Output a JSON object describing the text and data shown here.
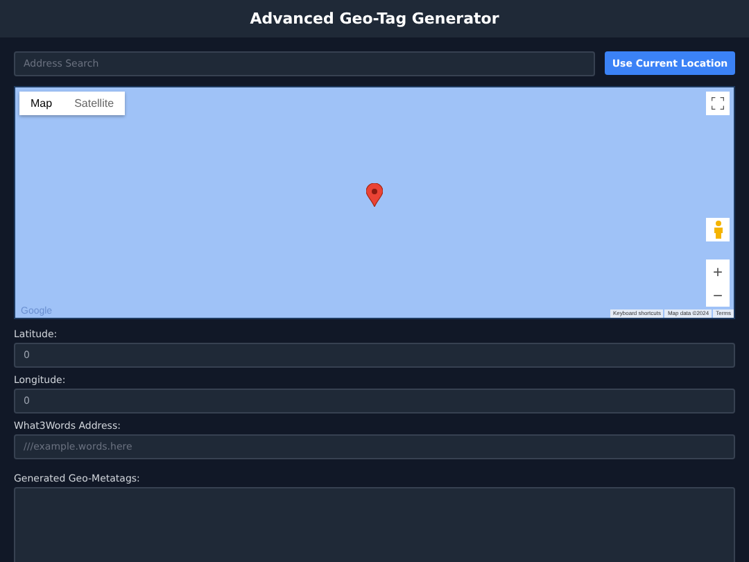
{
  "header": {
    "title": "Advanced Geo-Tag Generator"
  },
  "search": {
    "placeholder": "Address Search",
    "button": "Use Current Location"
  },
  "map": {
    "tabs": [
      {
        "label": "Map",
        "selected": true
      },
      {
        "label": "Satellite",
        "selected": false
      }
    ],
    "logo": "Google",
    "attribution": [
      "Keyboard shortcuts",
      "Map data ©2024",
      "Terms"
    ],
    "zoom_in": "+",
    "zoom_out": "−"
  },
  "fields": [
    {
      "label": "Latitude:",
      "value": "0"
    },
    {
      "label": "Longitude:",
      "value": "0"
    },
    {
      "label": "What3Words Address:",
      "placeholder": "///example.words.here"
    }
  ],
  "output": {
    "label": "Generated Geo-Metatags:"
  }
}
